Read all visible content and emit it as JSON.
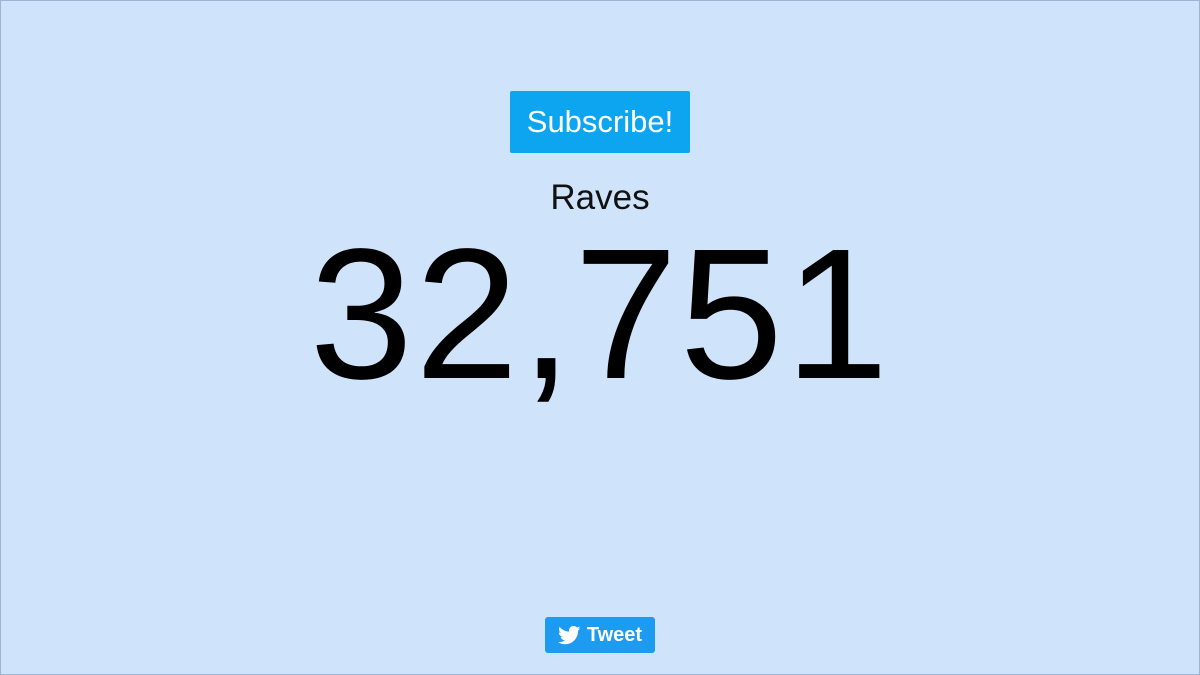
{
  "subscribe": {
    "label": "Subscribe!"
  },
  "counter": {
    "label": "Raves",
    "value": "32,751"
  },
  "tweet": {
    "label": "Tweet",
    "icon": "twitter-bird-icon"
  },
  "colors": {
    "background": "#cfe3fb",
    "subscribe_button": "#0ea5f0",
    "tweet_button": "#1d9bf0"
  }
}
